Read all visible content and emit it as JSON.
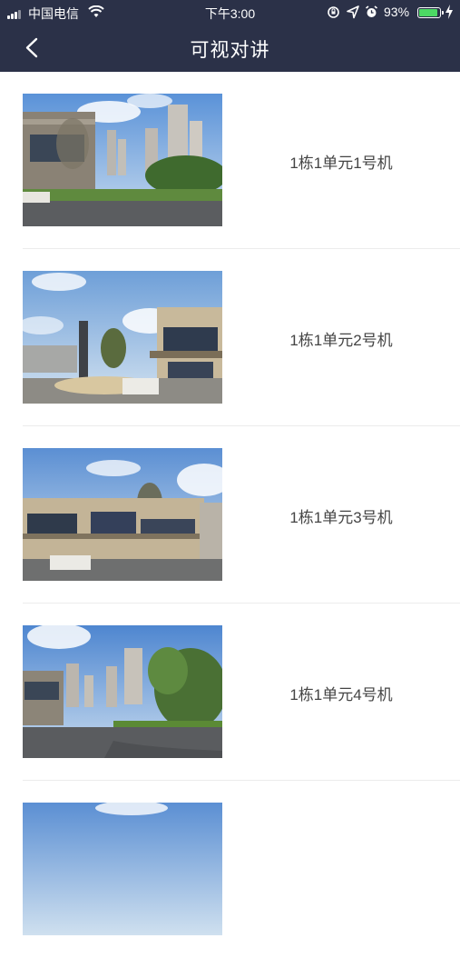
{
  "status_bar": {
    "carrier": "中国电信",
    "time": "下午3:00",
    "battery_percent": "93%",
    "battery_level": 0.93,
    "icons": [
      "signal-icon",
      "wifi-icon",
      "screen-lock-icon",
      "location-icon",
      "alarm-icon",
      "battery-icon",
      "charging-bolt-icon"
    ]
  },
  "nav": {
    "title": "可视对讲",
    "back_icon": "chevron-left-icon"
  },
  "colors": {
    "header_bg": "#2b3148",
    "battery_green": "#4cd964",
    "divider": "#ececec",
    "label_text": "#444444"
  },
  "intercom_list": [
    {
      "label": "1栋1单元1号机",
      "image": "building-entrance-photo"
    },
    {
      "label": "1栋1单元2号机",
      "image": "building-entrance-photo"
    },
    {
      "label": "1栋1单元3号机",
      "image": "building-entrance-photo"
    },
    {
      "label": "1栋1单元4号机",
      "image": "building-entrance-photo"
    },
    {
      "label": "",
      "image": "building-entrance-photo"
    }
  ]
}
